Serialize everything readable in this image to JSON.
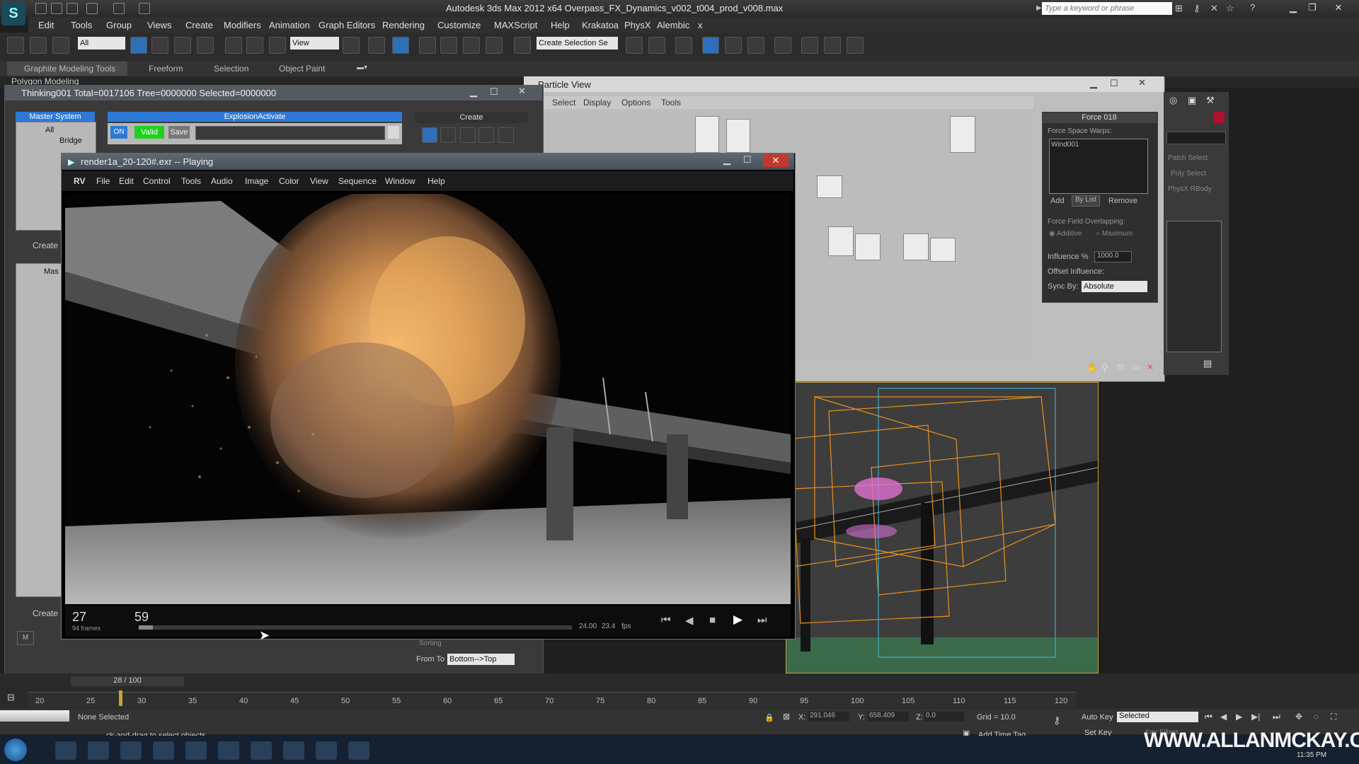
{
  "app": {
    "title": "Autodesk 3ds Max  2012 x64     Overpass_FX_Dynamics_v002_t004_prod_v008.max",
    "search_placeholder": "Type a keyword or phrase",
    "menu": [
      "Edit",
      "Tools",
      "Group",
      "Views",
      "Create",
      "Modifiers",
      "Animation",
      "Graph Editors",
      "Rendering",
      "Customize",
      "MAXScript",
      "Help",
      "Krakatoa",
      "PhysX",
      "Alembic",
      "x"
    ],
    "toolbar": {
      "selection_filter": "All",
      "ref_coord": "View",
      "named_selection": "Create Selection Se"
    },
    "ribbon_tabs": [
      "Graphite Modeling Tools",
      "Freeform",
      "Selection",
      "Object Paint"
    ],
    "subribbon": "Polygon Modeling"
  },
  "thinking": {
    "title": "Thinking001  Total=0017106  Tree=0000000  Selected=0000000",
    "master_system": "Master System",
    "tree": [
      "All",
      "Bridge"
    ],
    "explosion_header": "ExplosionActivate",
    "on_label": "ON",
    "valid_label": "Valid",
    "save_label": "Save",
    "create_label": "Create",
    "create_btn_1": "Create",
    "create_btn_2": "Create",
    "tree2_item": "Mas",
    "m_btn": "M",
    "sorting_label": "Sorting",
    "from_to_label": "From To",
    "from_to_value": "Bottom-->Top",
    "frame_counter": "28 / 100"
  },
  "particle_view": {
    "title": "Particle View",
    "menu": [
      "Select",
      "Display",
      "Options",
      "Tools"
    ],
    "force_title": "Force 018",
    "force_space_warps": "Force Space Warps:",
    "list_item": "Wind001",
    "add": "Add",
    "by_list": "By List",
    "remove": "Remove",
    "overlap_label": "Force Field Overlapping:",
    "additive": "Additive",
    "maximum": "Maximum",
    "influence_label": "Influence %",
    "influence_value": "1000.0",
    "offset_label": "Offset Influence:",
    "sync_by_label": "Sync By:",
    "sync_by_value": "Absolute"
  },
  "command_panel": {
    "items": [
      "Patch Select",
      "Poly Select",
      "PhysX RBody"
    ]
  },
  "rv": {
    "title": "render1a_20-120#.exr -- Playing",
    "menu": [
      "RV",
      "File",
      "Edit",
      "Control",
      "Tools",
      "Audio",
      "Image",
      "Color",
      "View",
      "Sequence",
      "Window",
      "Help"
    ],
    "frame_start": "27",
    "frames_label": "94 frames",
    "frame_current": "59",
    "fps_target": "24.00",
    "fps_actual": "23.4",
    "fps_unit": "fps"
  },
  "timeline": {
    "ticks": [
      "20",
      "25",
      "30",
      "35",
      "40",
      "45",
      "50",
      "55",
      "60",
      "65",
      "70",
      "75",
      "80",
      "85",
      "90",
      "95",
      "100",
      "105",
      "110",
      "115",
      "120"
    ]
  },
  "status": {
    "selection": "None Selected",
    "prompt": "ck-and-drag to select objects",
    "x_label": "X:",
    "x_value": "291.046",
    "y_label": "Y:",
    "y_value": "658.409",
    "z_label": "Z:",
    "z_value": "0.0",
    "grid": "Grid = 10.0",
    "auto_key": "Auto Key",
    "set_key": "Set Key",
    "key_mode": "Selected",
    "add_time_tag": "Add Time Tag",
    "key_filters": "Key Filters..."
  },
  "taskbar": {
    "clock": "11:35 PM",
    "watermark": "WWW.ALLANMCKAY.COM"
  },
  "colors": {
    "accent_blue": "#2e79d6",
    "valid_green": "#1fd11f",
    "viewport_orange": "#e89020"
  }
}
